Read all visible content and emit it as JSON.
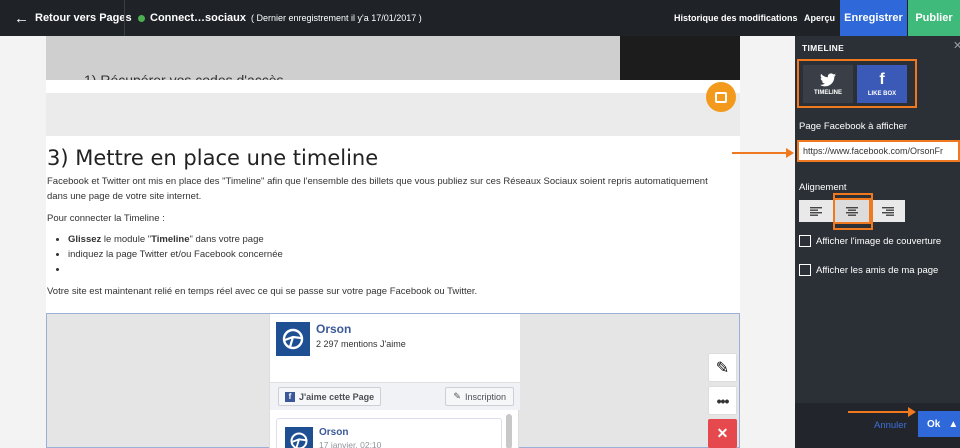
{
  "topbar": {
    "back_label": "Retour vers Pages",
    "page_name": "Connect…sociaux",
    "last_saved": "( Dernier enregistrement il y'a 17/01/2017 )",
    "history": "Historique des modifications",
    "preview": "Aperçu",
    "save": "Enregistrer",
    "publish": "Publier"
  },
  "content": {
    "cut_text": "1) Récupérer vos codes d'accès",
    "heading": "3) Mettre en place une timeline",
    "paragraph1": "Facebook et Twitter ont mis en place des \"Timeline\" afin que l'ensemble des billets que vous publiez sur ces Réseaux Sociaux soient repris automatiquement dans une page de votre site internet.",
    "paragraph2": "Pour connecter la Timeline :",
    "bullet1_bold": "Glissez",
    "bullet1_rest_a": " le module \"",
    "bullet1_bold2": "Timeline",
    "bullet1_rest_b": "\" dans votre page",
    "bullet2": "indiquez la page Twitter et/ou Facebook concernée",
    "bullet3": "",
    "paragraph3": "Votre site est maintenant relié en temps réel avec ce qui se passe sur votre page Facebook ou Twitter."
  },
  "facebook_widget": {
    "page_name": "Orson",
    "likes": "2 297 mentions J'aime",
    "like_button": "J'aime cette Page",
    "subscribe_button": "Inscription",
    "post_author": "Orson",
    "post_date": "17 janvier, 02:10"
  },
  "panel": {
    "title": "TIMELINE",
    "tab_timeline": "TIMELINE",
    "tab_likebox": "LIKE BOX",
    "fb_page_label": "Page Facebook à afficher",
    "fb_page_value": "https://www.facebook.com/OrsonFr",
    "alignment_label": "Alignement",
    "show_cover": "Afficher l'image de couverture",
    "show_friends": "Afficher les amis de ma page",
    "cancel": "Annuler",
    "ok": "Ok"
  },
  "colors": {
    "topbar_bg": "#1f2328",
    "save_blue": "#2f69d9",
    "publish_green": "#3fba7a",
    "panel_bg": "#2b2f36",
    "annotation_orange": "#f0781e",
    "facebook_blue": "#3b5998",
    "delete_red": "#e5484d"
  }
}
